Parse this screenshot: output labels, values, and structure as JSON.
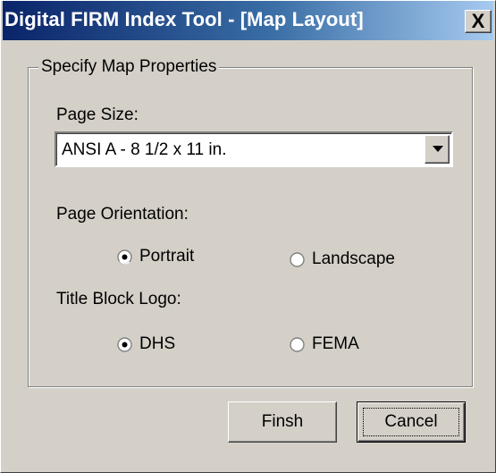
{
  "window": {
    "title": "Digital FIRM Index Tool - [Map Layout]",
    "close_glyph": "X"
  },
  "group": {
    "legend": "Specify Map Properties"
  },
  "page_size": {
    "label": "Page Size:",
    "selected": "ANSI A - 8 1/2 x 11 in."
  },
  "orientation": {
    "label": "Page Orientation:",
    "options": [
      {
        "label": "Portrait",
        "selected": true
      },
      {
        "label": "Landscape",
        "selected": false
      }
    ]
  },
  "logo": {
    "label": "Title Block Logo:",
    "options": [
      {
        "label": "DHS",
        "selected": true
      },
      {
        "label": "FEMA",
        "selected": false
      }
    ]
  },
  "buttons": {
    "finish": "Finsh",
    "cancel": "Cancel"
  },
  "colors": {
    "titlebar_start": "#0a246a",
    "titlebar_end": "#a6caf0",
    "face": "#d4d0c8"
  }
}
